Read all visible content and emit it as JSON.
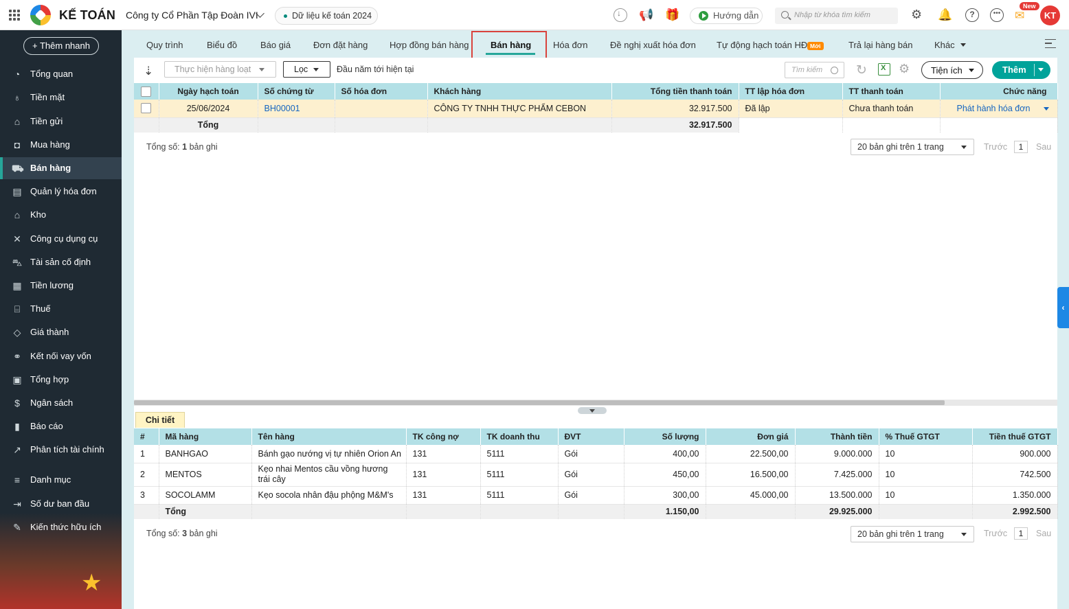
{
  "header": {
    "logo_text": "KẾ TOÁN",
    "company": "Công ty Cổ Phần Tập Đoàn IVI",
    "data_year": "Dữ liệu kế toán 2024",
    "guide": "Hướng dẫn",
    "search_placeholder": "Nhập từ khóa tìm kiếm",
    "new_badge": "New",
    "avatar": "KT"
  },
  "sidebar": {
    "quick_add": "+ Thêm nhanh",
    "items": [
      {
        "label": "Tổng quan",
        "icon": "speedometer-icon"
      },
      {
        "label": "Tiền mặt",
        "icon": "money-bag-icon"
      },
      {
        "label": "Tiền gửi",
        "icon": "bank-icon"
      },
      {
        "label": "Mua hàng",
        "icon": "shopping-bag-icon"
      },
      {
        "label": "Bán hàng",
        "icon": "cart-icon",
        "active": true
      },
      {
        "label": "Quản lý hóa đơn",
        "icon": "invoice-icon"
      },
      {
        "label": "Kho",
        "icon": "warehouse-icon"
      },
      {
        "label": "Công cụ dụng cụ",
        "icon": "tools-icon"
      },
      {
        "label": "Tài sản cố định",
        "icon": "car-icon"
      },
      {
        "label": "Tiền lương",
        "icon": "payroll-icon"
      },
      {
        "label": "Thuế",
        "icon": "tax-building-icon"
      },
      {
        "label": "Giá thành",
        "icon": "price-tag-icon"
      },
      {
        "label": "Kết nối vay vốn",
        "icon": "link-icon"
      },
      {
        "label": "Tổng hợp",
        "icon": "summary-icon"
      },
      {
        "label": "Ngân sách",
        "icon": "budget-icon"
      },
      {
        "label": "Báo cáo",
        "icon": "bar-chart-icon"
      },
      {
        "label": "Phân tích tài chính",
        "icon": "analytics-icon"
      },
      {
        "label": "Danh mục",
        "icon": "list-icon"
      },
      {
        "label": "Số dư ban đầu",
        "icon": "opening-balance-icon"
      },
      {
        "label": "Kiến thức hữu ích",
        "icon": "knowledge-icon"
      }
    ]
  },
  "tabs": [
    {
      "label": "Quy trình"
    },
    {
      "label": "Biểu đồ"
    },
    {
      "label": "Báo giá"
    },
    {
      "label": "Đơn đặt hàng"
    },
    {
      "label": "Hợp đồng bán hàng"
    },
    {
      "label": "Bán hàng",
      "active": true
    },
    {
      "label": "Hóa đơn"
    },
    {
      "label": "Đề nghị xuất hóa đơn"
    },
    {
      "label": "Tự động hạch toán HĐ",
      "badge": "Mới"
    },
    {
      "label": "Trả lại hàng bán"
    },
    {
      "label": "Khác"
    }
  ],
  "toolbar": {
    "batch": "Thực hiện hàng loạt",
    "filter": "Lọc",
    "period": "Đầu năm tới hiện tại",
    "search_placeholder": "Tìm kiếm",
    "utils": "Tiện ích",
    "add": "Thêm"
  },
  "upper_table": {
    "columns": [
      "Ngày hạch toán",
      "Số chứng từ",
      "Số hóa đơn",
      "Khách hàng",
      "Tổng tiền thanh toán",
      "TT lập hóa đơn",
      "TT thanh toán",
      "Chức năng"
    ],
    "rows": [
      {
        "date": "25/06/2024",
        "voucher": "BH00001",
        "invoice_no": "",
        "customer": "CÔNG TY TNHH THỰC PHẨM CEBON",
        "total": "32.917.500",
        "invoice_status": "Đã lập",
        "payment_status": "Chưa thanh toán",
        "action": "Phát hành hóa đơn"
      }
    ],
    "total_label": "Tổng",
    "total_value": "32.917.500",
    "count_prefix": "Tổng số:",
    "count_value": "1",
    "count_suffix": "bản ghi"
  },
  "pager": {
    "page_size": "20 bản ghi trên 1 trang",
    "prev": "Trước",
    "page": "1",
    "next": "Sau"
  },
  "detail": {
    "tab_label": "Chi tiết",
    "columns": [
      "#",
      "Mã hàng",
      "Tên hàng",
      "TK công nợ",
      "TK doanh thu",
      "ĐVT",
      "Số lượng",
      "Đơn giá",
      "Thành tiền",
      "% Thuế GTGT",
      "Tiền thuế GTGT"
    ],
    "rows": [
      {
        "no": "1",
        "code": "BANHGAO",
        "name": "Bánh gạo nướng vị tự nhiên Orion An",
        "ar": "131",
        "rev": "5111",
        "unit": "Gói",
        "qty": "400,00",
        "price": "22.500,00",
        "amount": "9.000.000",
        "vat_rate": "10",
        "vat": "900.000"
      },
      {
        "no": "2",
        "code": "MENTOS",
        "name": "Kẹo nhai Mentos cầu vồng hương trái cây",
        "ar": "131",
        "rev": "5111",
        "unit": "Gói",
        "qty": "450,00",
        "price": "16.500,00",
        "amount": "7.425.000",
        "vat_rate": "10",
        "vat": "742.500"
      },
      {
        "no": "3",
        "code": "SOCOLAMM",
        "name": "Kẹo socola nhân đậu phộng M&M's",
        "ar": "131",
        "rev": "5111",
        "unit": "Gói",
        "qty": "300,00",
        "price": "45.000,00",
        "amount": "13.500.000",
        "vat_rate": "10",
        "vat": "1.350.000"
      }
    ],
    "total_label": "Tổng",
    "total_qty": "1.150,00",
    "total_amount": "29.925.000",
    "total_vat": "2.992.500",
    "count_prefix": "Tổng số:",
    "count_value": "3",
    "count_suffix": "bản ghi"
  }
}
